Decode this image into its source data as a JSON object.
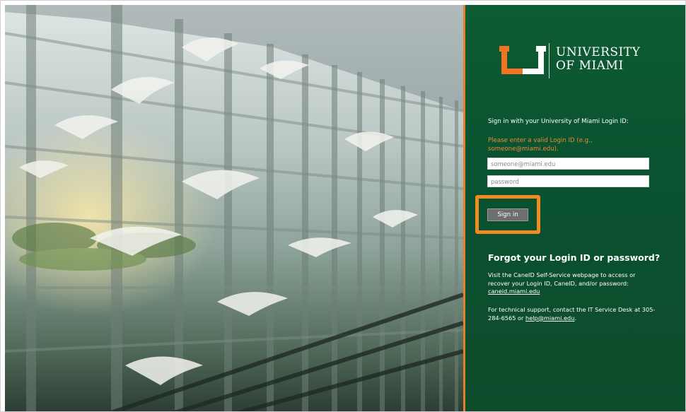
{
  "brand": {
    "line1": "UNIVERSITY",
    "line2": "OF MIAMI",
    "orange": "#F47321",
    "green": "#005030"
  },
  "login": {
    "prompt": "Sign in with your University of Miami Login ID:",
    "error": "Please enter a valid Login ID (e.g., someone@miami.edu).",
    "username_placeholder": "someone@miami.edu",
    "password_placeholder": "password",
    "signin_label": "Sign in"
  },
  "help": {
    "title": "Forgot your Login ID or password?",
    "body": "Visit the CaneID Self-Service webpage to access or recover your Login ID, CaneID, and/or password:",
    "cane_link": "caneid.miami.edu",
    "support_text": "For technical support, contact the IT Service Desk at 305-284-6565 or",
    "support_email": "help@miami.edu",
    "support_end": "."
  }
}
